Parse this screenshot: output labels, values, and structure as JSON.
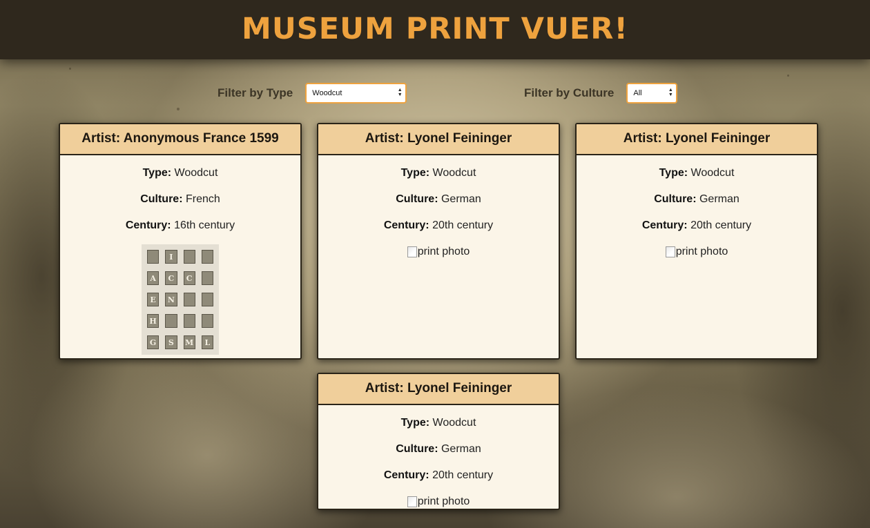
{
  "app": {
    "title": "MUSEUM PRINT VUER!"
  },
  "filters": {
    "type": {
      "label": "Filter by Type",
      "selected": "Woodcut"
    },
    "culture": {
      "label": "Filter by Culture",
      "selected": "All"
    }
  },
  "cards": [
    {
      "artist_label": "Artist:",
      "artist": "Anonymous France 1599",
      "type_label": "Type:",
      "type": "Woodcut",
      "culture_label": "Culture:",
      "culture": "French",
      "century_label": "Century:",
      "century": "16th century",
      "image_shown": true,
      "image_alt": "print photo"
    },
    {
      "artist_label": "Artist:",
      "artist": "Lyonel Feininger",
      "type_label": "Type:",
      "type": "Woodcut",
      "culture_label": "Culture:",
      "culture": "German",
      "century_label": "Century:",
      "century": "20th century",
      "image_shown": false,
      "image_alt": "print photo"
    },
    {
      "artist_label": "Artist:",
      "artist": "Lyonel Feininger",
      "type_label": "Type:",
      "type": "Woodcut",
      "culture_label": "Culture:",
      "culture": "German",
      "century_label": "Century:",
      "century": "20th century",
      "image_shown": false,
      "image_alt": "print photo"
    },
    {
      "artist_label": "Artist:",
      "artist": "Lyonel Feininger",
      "type_label": "Type:",
      "type": "Woodcut",
      "culture_label": "Culture:",
      "culture": "German",
      "century_label": "Century:",
      "century": "20th century",
      "image_shown": false,
      "image_alt": "print photo"
    }
  ],
  "plate_letters": [
    "",
    "I",
    "",
    "",
    "A",
    "C",
    "C",
    "",
    "E",
    "N",
    "",
    "",
    "H",
    "",
    "",
    "",
    "G",
    "S",
    "M",
    "L"
  ],
  "colors": {
    "header_bg": "#2f281d",
    "title": "#eea23e",
    "card_header": "#f0cf9b",
    "card_bg": "#fbf5e8",
    "select_border": "#eea23e"
  },
  "icons": {
    "select_arrows": "up-down-arrows-icon",
    "broken_image": "broken-image-icon"
  }
}
